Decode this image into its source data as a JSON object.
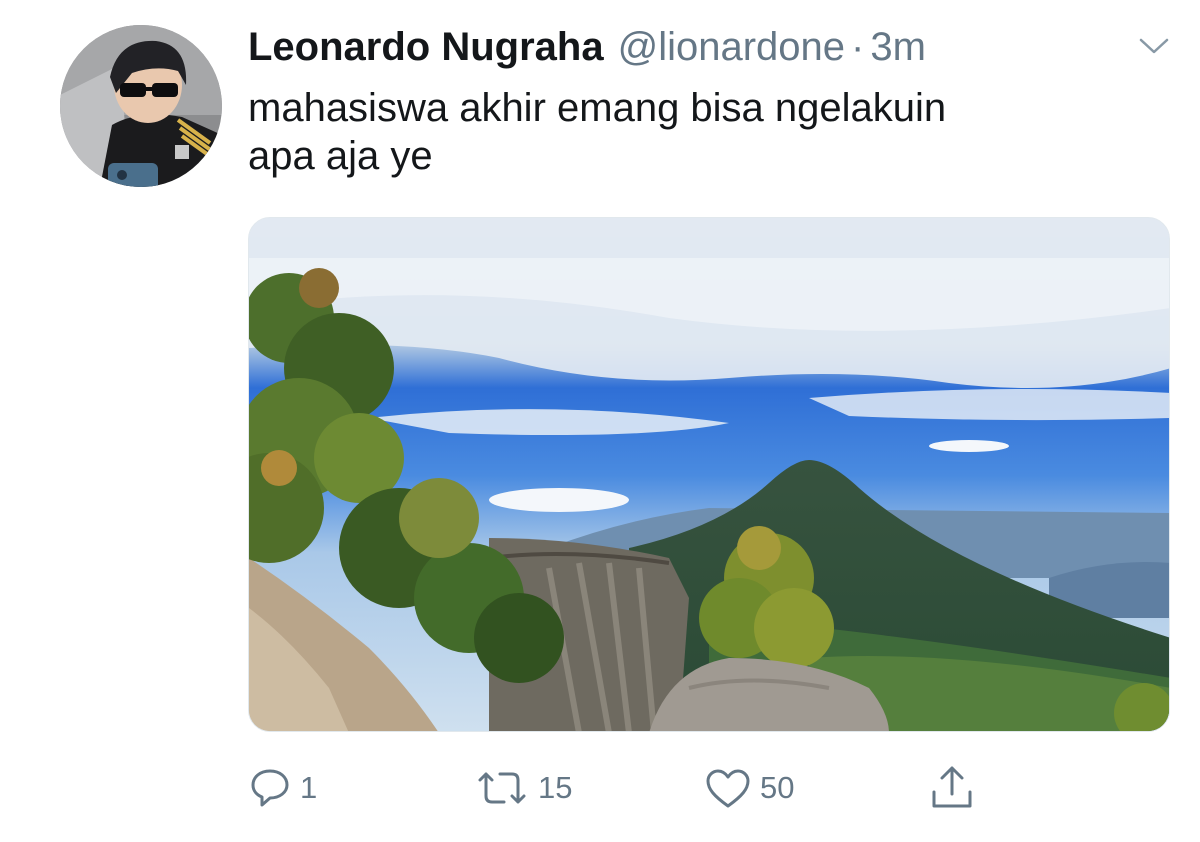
{
  "tweet": {
    "display_name": "Leonardo Nugraha",
    "handle": "@lionardone",
    "separator": "·",
    "time": "3m",
    "text": "mahasiswa akhir emang bisa ngelakuin\napa aja ye"
  },
  "avatar": {
    "icon": "profile-photo"
  },
  "menu": {
    "icon": "chevron-down-icon"
  },
  "media": {
    "subject": "mountain-landscape-photo"
  },
  "actions": {
    "reply_count": "1",
    "retweet_count": "15",
    "like_count": "50"
  },
  "colors": {
    "text_primary": "#14171a",
    "text_secondary": "#657786",
    "border": "#e1e8ed"
  }
}
